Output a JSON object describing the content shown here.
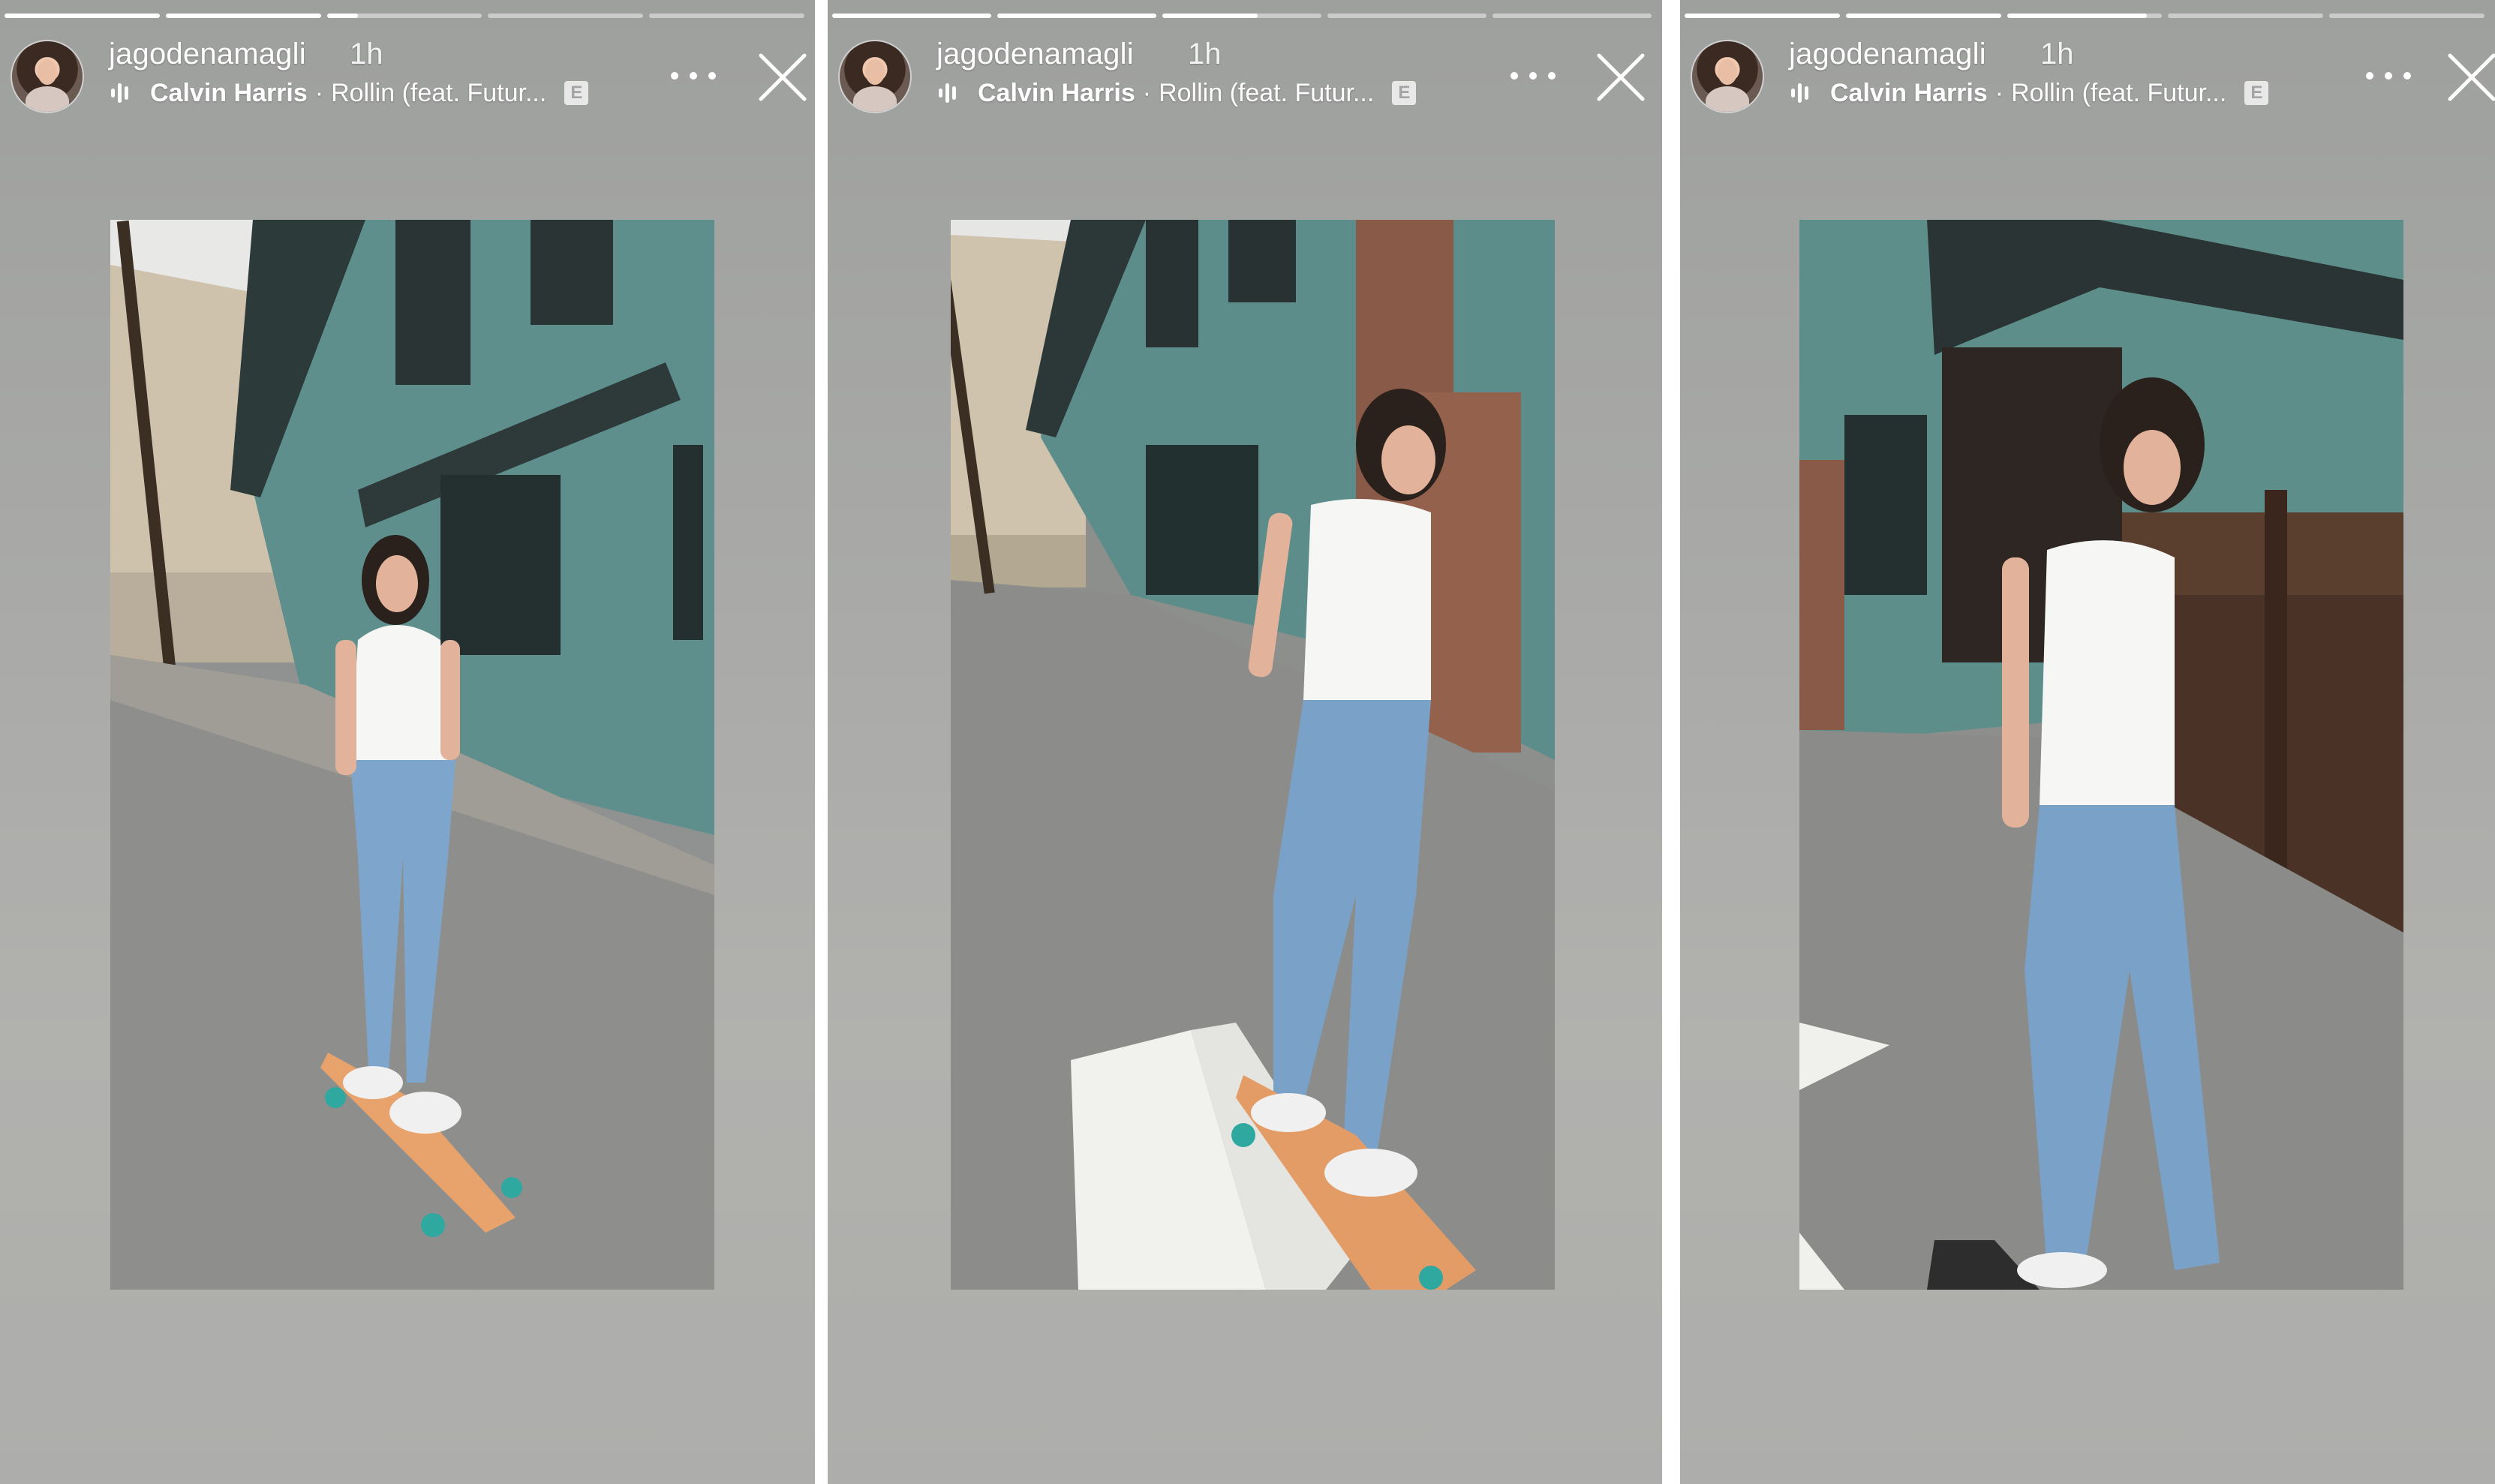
{
  "stories": [
    {
      "username": "jagodenamagli",
      "time": "1h",
      "artist": "Calvin Harris",
      "separator": "·",
      "track": "Rollin (feat. Futur...",
      "explicit": "E",
      "progress": [
        1,
        1,
        0.2,
        0,
        0
      ]
    },
    {
      "username": "jagodenamagli",
      "time": "1h",
      "artist": "Calvin Harris",
      "separator": "·",
      "track": "Rollin (feat. Futur...",
      "explicit": "E",
      "progress": [
        1,
        1,
        0.6,
        0,
        0
      ]
    },
    {
      "username": "jagodenamagli",
      "time": "1h",
      "artist": "Calvin Harris",
      "separator": "·",
      "track": "Rollin (feat. Futur...",
      "explicit": "E",
      "progress": [
        1,
        1,
        0.9,
        0,
        0
      ]
    }
  ],
  "icons": {
    "music": "audio-wave-icon",
    "more": "more-icon",
    "close": "close-icon"
  },
  "colors": {
    "background": "#a9aaa8",
    "text": "#ffffff"
  }
}
